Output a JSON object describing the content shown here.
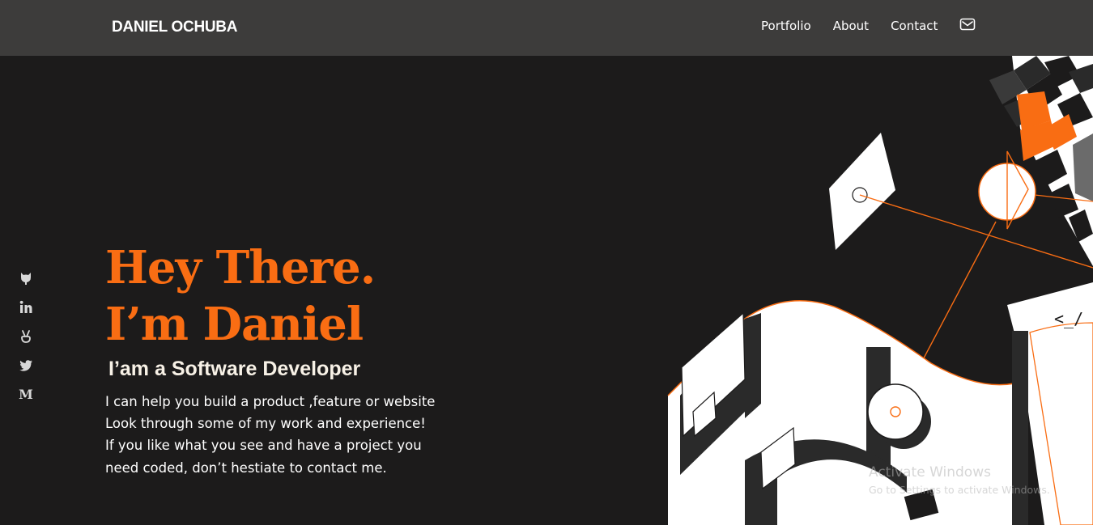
{
  "header": {
    "brand": "DANIEL OCHUBA",
    "nav": [
      {
        "label": "Portfolio"
      },
      {
        "label": "About"
      },
      {
        "label": "Contact"
      }
    ],
    "mail_icon": "mail-icon"
  },
  "socials": [
    {
      "icon": "github-icon"
    },
    {
      "icon": "linkedin-icon"
    },
    {
      "icon": "angellist-icon"
    },
    {
      "icon": "twitter-icon"
    },
    {
      "icon": "medium-icon",
      "glyph": "M"
    }
  ],
  "hero": {
    "title_line1": "Hey There.",
    "title_line2": "I’m Daniel",
    "subtitle": "I’am a Software Developer",
    "description": "I can help you build a product ,feature or website Look through some of my work and experience! If you like what you see and have a project you need coded, don’t hestiate to contact me.",
    "code_glyph": "<_/"
  },
  "watermark": {
    "title": "Activate Windows",
    "subtitle": "Go to Settings to activate Windows."
  },
  "colors": {
    "accent": "#f96d13",
    "background": "#1c1b1b",
    "navbar": "#3d3c3b",
    "subtitle": "#f7f1e6"
  }
}
